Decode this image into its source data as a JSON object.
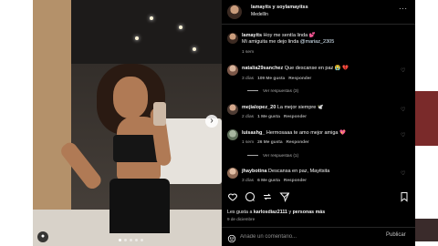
{
  "post": {
    "owner": "lamayits y soylamayitss",
    "location": "Medellín",
    "more_icon": "more-horizontal-icon"
  },
  "caption": {
    "username": "lamayits",
    "line1": "Hoy me sentía linda 💕",
    "line2_prefix": "Mi amiguita me dejo linda ",
    "mention": "@mariaz_2305",
    "age": "1 sem"
  },
  "comments": [
    {
      "username": "natalia29sanchez",
      "text": "Que descanse en paz 😭 💔",
      "age": "3 días",
      "likes": "109 Me gusta",
      "reply": "Responder",
      "view_replies": "Ver respuestas (3)"
    },
    {
      "username": "mejialopez_20",
      "text": "La mejor siempre 🕊️",
      "age": "2 días",
      "likes": "1 Me gusta",
      "reply": "Responder"
    },
    {
      "username": "luisashg_",
      "text": "Hermosaaa te amo mejor amiga 💖",
      "age": "1 sem",
      "likes": "26 Me gusta",
      "reply": "Responder",
      "view_replies": "Ver respuestas (1)"
    },
    {
      "username": "jhaybotina",
      "text": "Descansa en paz, Mayitsita",
      "age": "3 días",
      "likes": "6 Me gusta",
      "reply": "Responder"
    }
  ],
  "actions": {
    "like_icon": "heart-icon",
    "comment_icon": "comment-icon",
    "share_icon": "share-icon",
    "send_icon": "send-icon",
    "save_icon": "bookmark-icon"
  },
  "likes_summary": {
    "prefix": "Les gusta a ",
    "user": "karlosdiaz2111",
    "middle": " y ",
    "others": "personas más"
  },
  "date": "9 de diciembre",
  "comment_box": {
    "placeholder": "Añade un comentario...",
    "publish": "Publicar"
  },
  "colors": {
    "panel_bg": "#000000",
    "text_primary": "#f5f5f5",
    "text_secondary": "#a8a8a8"
  }
}
